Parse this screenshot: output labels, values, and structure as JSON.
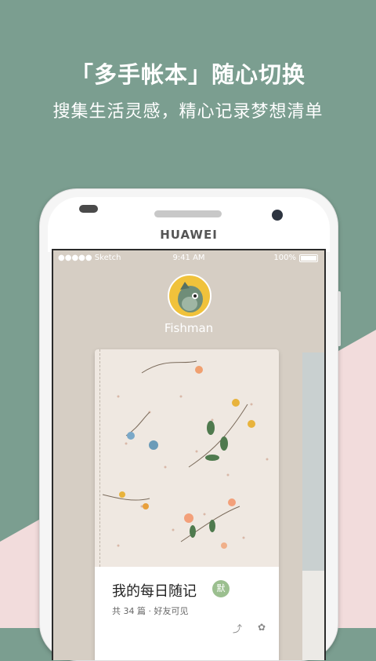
{
  "headline": "「多手帐本」随心切换",
  "subheadline": "搜集生活灵感，精心记录梦想清单",
  "phone": {
    "brand": "HUAWEI"
  },
  "status_bar": {
    "carrier": "●●●●● Sketch",
    "time": "9:41 AM",
    "battery": "100%"
  },
  "profile": {
    "name": "Fishman"
  },
  "notebook": {
    "title": "我的每日随记",
    "badge": "默",
    "meta": "共 34 篇 · 好友可见"
  },
  "colors": {
    "background": "#7b9e90",
    "accent_pink": "#f3dcdc",
    "screen_bg": "#d6cec4",
    "badge": "#9bbf8f"
  }
}
